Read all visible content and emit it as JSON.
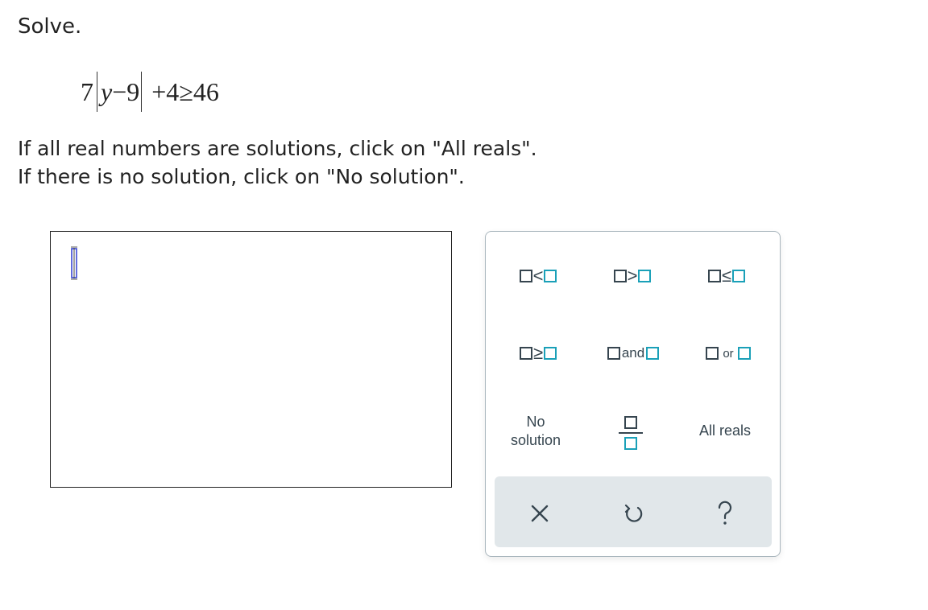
{
  "prompt": "Solve.",
  "equation": {
    "coefficient": "7",
    "abs_variable": "y",
    "abs_rest": "−9",
    "after_abs": "+4≥46"
  },
  "instructions": {
    "line1": "If all real numbers are solutions, click on \"All reals\".",
    "line2": "If there is no solution, click on \"No solution\"."
  },
  "answer_box": {
    "value": ""
  },
  "keypad": {
    "keys": {
      "less_than": "<",
      "greater_than": ">",
      "less_equal": "≤",
      "greater_equal": "≥",
      "and": "and",
      "or": "or",
      "no_solution_line1": "No",
      "no_solution_line2": "solution",
      "all_reals": "All reals"
    },
    "actions": [
      "clear-icon",
      "undo-icon",
      "help-icon"
    ]
  },
  "colors": {
    "accent_box": "#1aa0b8",
    "cursor": "#3a47d5",
    "action_bar": "#e1e7ea",
    "icon": "#36454f"
  }
}
